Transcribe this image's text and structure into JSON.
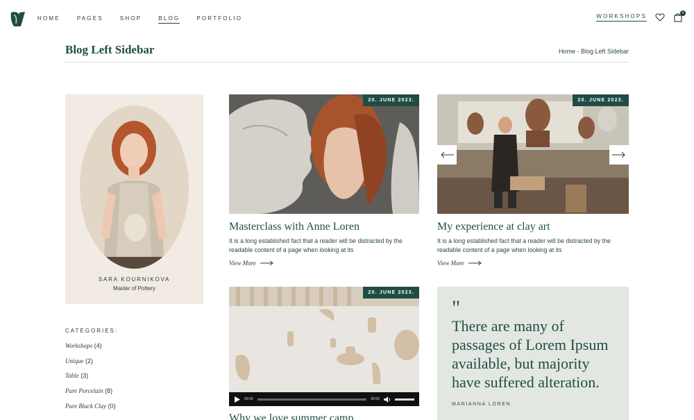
{
  "header": {
    "nav": [
      "HOME",
      "PAGES",
      "SHOP",
      "BLOG",
      "PORTFOLIO"
    ],
    "active_nav": "BLOG",
    "workshops_label": "WORKSHOPS",
    "cart_count": "0",
    "icons": [
      "logo-icon",
      "heart-icon",
      "cart-icon"
    ]
  },
  "page": {
    "title": "Blog Left Sidebar",
    "breadcrumb": "Home - Blog Left Sidebar"
  },
  "sidebar": {
    "profile": {
      "name": "SARA KOURNIKOVA",
      "role": "Master of Pottery"
    },
    "categories_title": "CATEGORIES:",
    "categories": [
      {
        "name": "Workshops",
        "count": "(4)"
      },
      {
        "name": "Unique",
        "count": "(2)"
      },
      {
        "name": "Table",
        "count": "(3)"
      },
      {
        "name": "Pure Porcelain",
        "count": "(8)"
      },
      {
        "name": "Pure Black Clay",
        "count": "(0)"
      }
    ]
  },
  "posts": [
    {
      "date": "20. JUNE 2023.",
      "title": "Masterclass with Anne Loren",
      "excerpt": "It is a long established fact that a reader will be distracted by the readable content of a page when looking at its",
      "link": "View More"
    },
    {
      "date": "20. JUNE 2023.",
      "title": "My experience at clay art",
      "excerpt": "It is a long established fact that a reader will be distracted by the readable content of a page when looking at its",
      "link": "View More"
    },
    {
      "date": "20. JUNE 2023.",
      "title": "Why we love summer camp",
      "video": {
        "current": "00:00",
        "duration": "00:00"
      }
    }
  ],
  "quote": {
    "mark": "\"",
    "text": "There are many of passages of Lorem Ipsum available, but majority have suffered alteration.",
    "author": "MARIANNA LOREN"
  },
  "colors": {
    "accent": "#1f4d44",
    "card_beige": "#f1ebe3",
    "quote_bg": "#e3e7e2"
  }
}
